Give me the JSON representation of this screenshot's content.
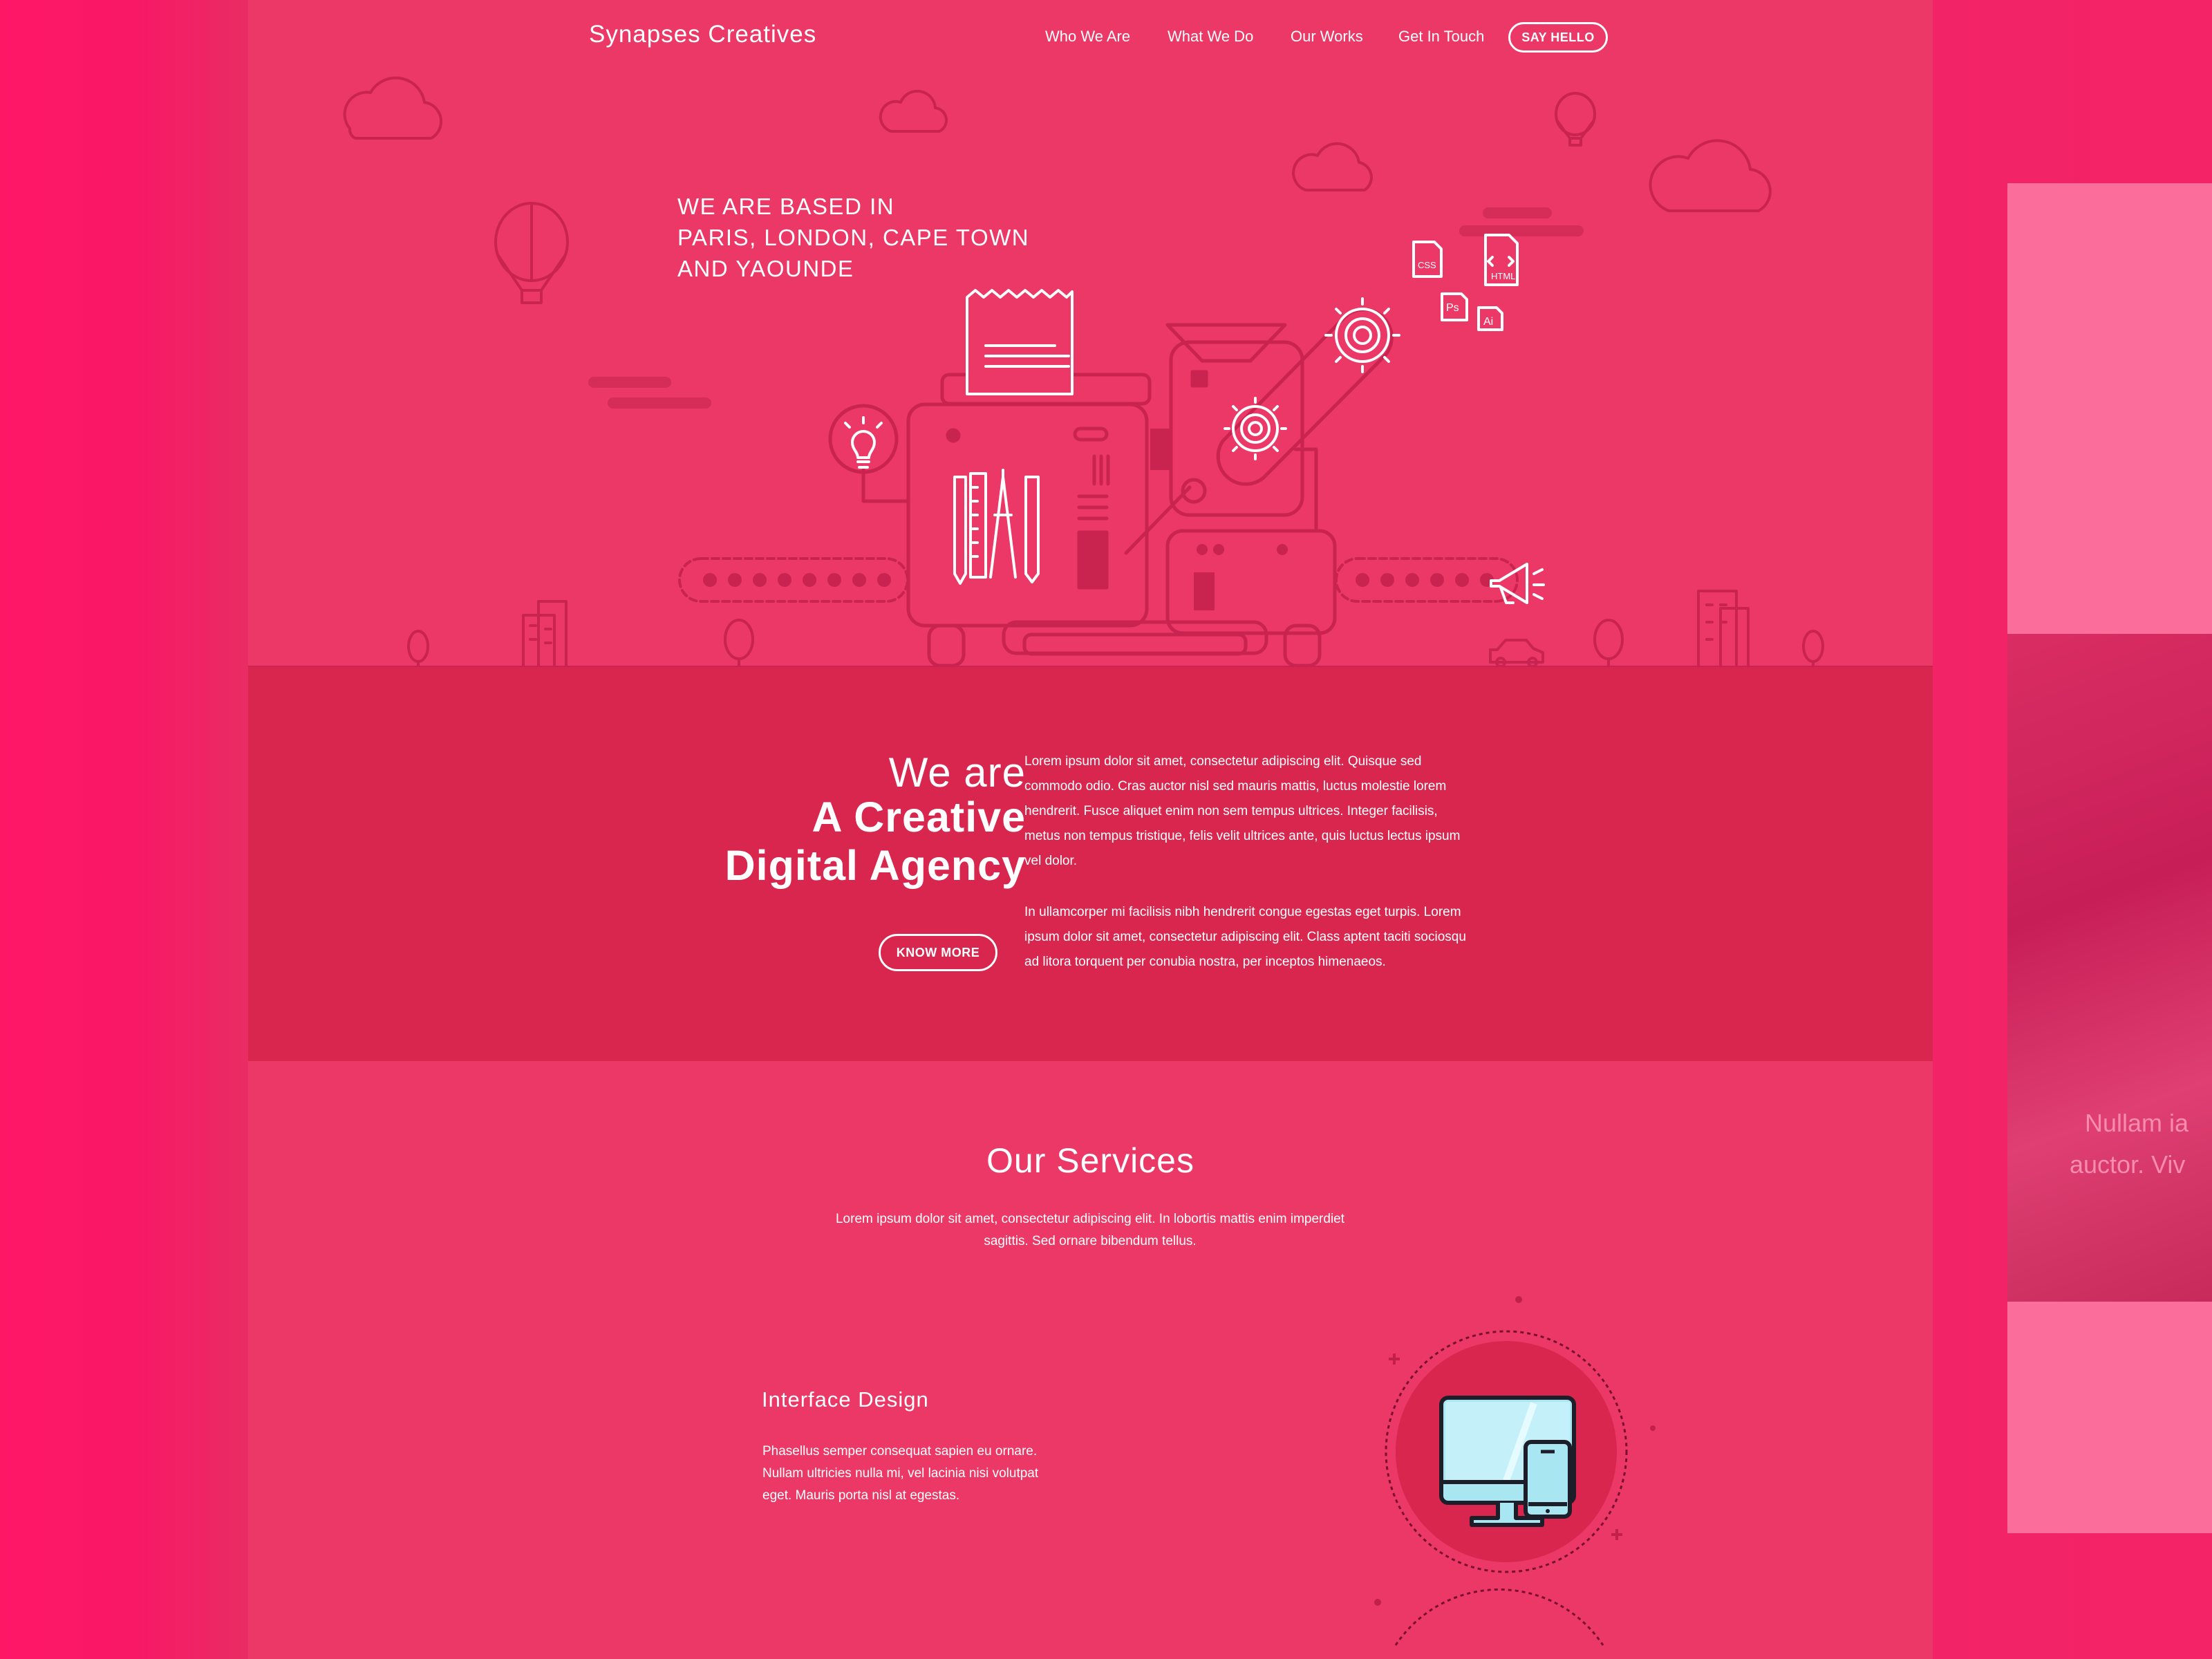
{
  "header": {
    "logo": "Synapses Creatives",
    "nav": [
      "Who We Are",
      "What We Do",
      "Our Works",
      "Get In Touch"
    ],
    "cta": "SAY HELLO"
  },
  "hero": {
    "cities": [
      "WE ARE BASED IN",
      "PARIS, LONDON, CAPE TOWN",
      "AND YAOUNDE"
    ],
    "file_icons": [
      "CSS",
      "HTML",
      "Ps",
      "Ai"
    ]
  },
  "about": {
    "line1": "We are",
    "line2": "A Creative",
    "line3": "Digital Agency",
    "button": "KNOW MORE",
    "paragraph1": [
      "Lorem ipsum dolor sit amet, consectetur adipiscing elit. Quisque sed",
      "commodo odio. Cras auctor nisl sed mauris mattis, luctus molestie lorem",
      "hendrerit. Fusce aliquet enim non sem tempus ultrices. Integer facilisis,",
      "metus non tempus tristique, felis velit ultrices ante, quis luctus lectus ipsum",
      "vel dolor."
    ],
    "paragraph2": [
      "In ullamcorper mi facilisis nibh hendrerit congue egestas eget turpis. Lorem",
      "ipsum dolor sit amet, consectetur adipiscing elit. Class aptent taciti sociosqu",
      "ad litora torquent per conubia nostra, per inceptos himenaeos."
    ]
  },
  "services": {
    "title": "Our Services",
    "subtitle": [
      "Lorem ipsum dolor sit amet, consectetur adipiscing elit. In lobortis mattis enim imperdiet",
      "sagittis. Sed ornare bibendum tellus."
    ],
    "items": [
      {
        "title": "Interface Design",
        "description": [
          "Phasellus semper consequat sapien eu ornare.",
          "Nullam ultricies nulla mi, vel lacinia nisi volutpat",
          "eget. Mauris porta nisl at egestas."
        ]
      }
    ]
  },
  "side_preview": {
    "lines": [
      "Nullam ia",
      "auctor. Viv"
    ]
  },
  "colors": {
    "page_bg": "#ec3866",
    "band_bg": "#d9264f",
    "outer_bg": "#ff1766",
    "line_art": "#c9234f",
    "white": "#ffffff"
  }
}
